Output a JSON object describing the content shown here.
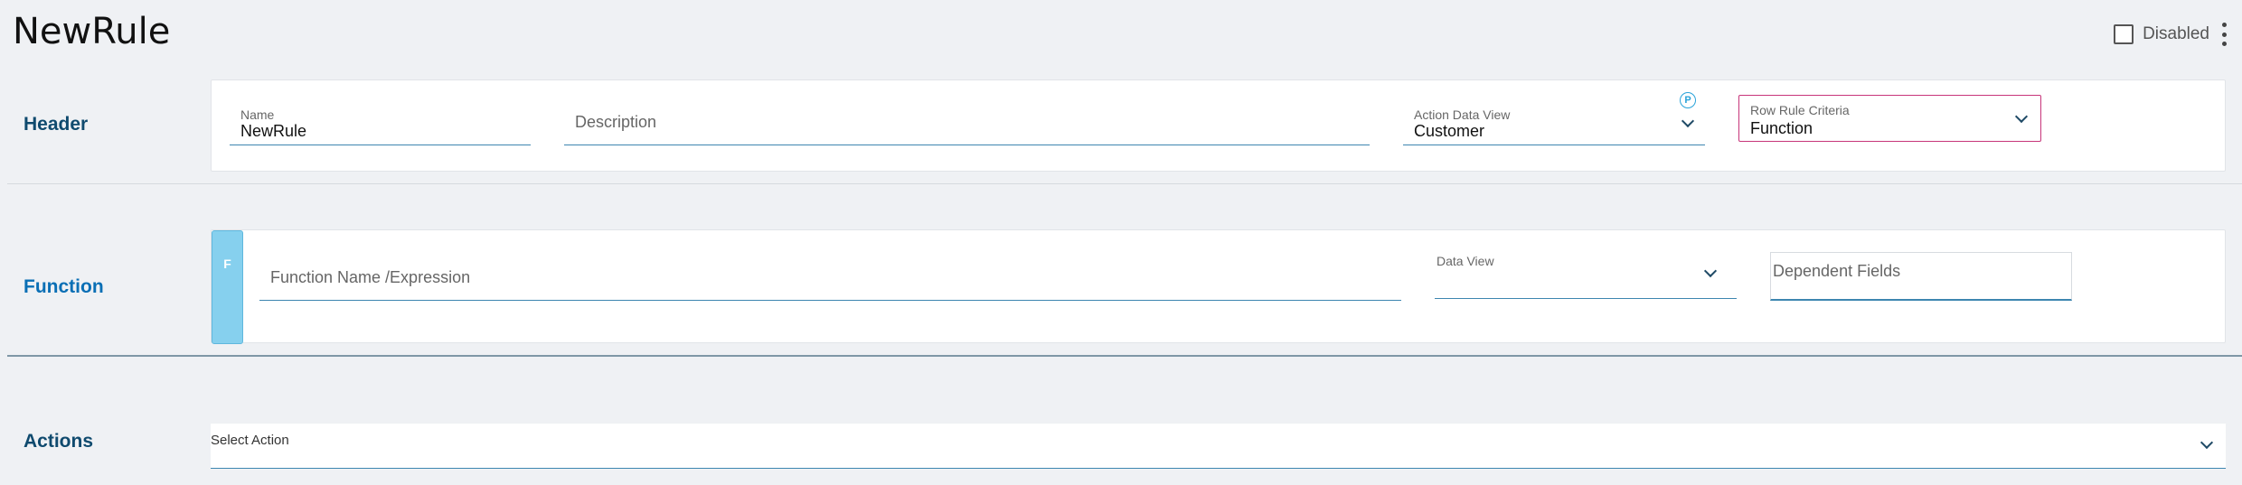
{
  "page": {
    "title": "NewRule"
  },
  "top_right": {
    "disabled_label": "Disabled",
    "disabled_checked": false
  },
  "sections": {
    "header": {
      "label": "Header"
    },
    "function": {
      "label": "Function"
    },
    "actions": {
      "label": "Actions"
    }
  },
  "header_fields": {
    "name": {
      "label": "Name",
      "value": "NewRule"
    },
    "description": {
      "placeholder": "Description"
    },
    "action_data_view": {
      "label": "Action Data View",
      "value": "Customer",
      "badge": "P"
    },
    "row_rule_criteria": {
      "label": "Row Rule Criteria",
      "value": "Function"
    }
  },
  "function_fields": {
    "tab_letter": "F",
    "name_expression": {
      "placeholder": "Function Name /Expression"
    },
    "data_view": {
      "label": "Data View"
    },
    "dependent_fields": {
      "placeholder": "Dependent Fields"
    }
  },
  "actions": {
    "select_placeholder": "Select Action"
  },
  "icons": [
    "chevron-down-icon",
    "kebab-menu-icon",
    "checkbox-icon",
    "p-badge-icon"
  ],
  "colors": {
    "accent_blue": "#3d86b0",
    "criteria_border": "#c7357a",
    "function_tab": "#86d0ee",
    "section_label": "#0f4a6e"
  }
}
